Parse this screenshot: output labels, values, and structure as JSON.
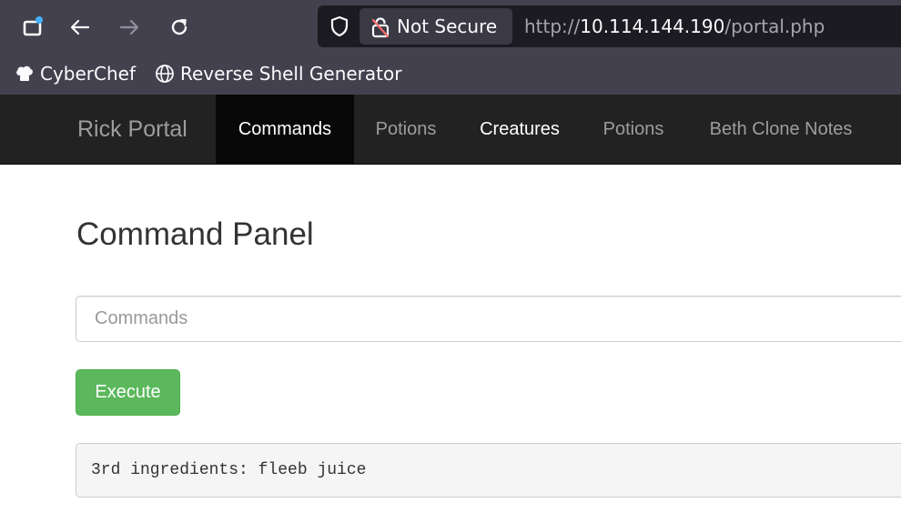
{
  "browser": {
    "security_label": "Not Secure",
    "url_scheme": "http://",
    "url_host": "10.114.144.190",
    "url_path": "/portal.php",
    "bookmarks": [
      {
        "label": "CyberChef",
        "icon": "chef-hat-icon"
      },
      {
        "label": "Reverse Shell Generator",
        "icon": "globe-icon"
      }
    ]
  },
  "navbar": {
    "brand": "Rick Portal",
    "items": [
      {
        "label": "Commands",
        "active": true
      },
      {
        "label": "Potions",
        "active": false
      },
      {
        "label": "Creatures",
        "active": false
      },
      {
        "label": "Potions",
        "active": false
      },
      {
        "label": "Beth Clone Notes",
        "active": false
      }
    ]
  },
  "main": {
    "title": "Command Panel",
    "command_input": {
      "placeholder": "Commands",
      "value": ""
    },
    "execute_label": "Execute",
    "output": "3rd ingredients: fleeb juice"
  },
  "colors": {
    "chrome_bg": "#42414d",
    "urlbar_bg": "#1c1b22",
    "navbar_bg": "#222222",
    "nav_active_bg": "#080808",
    "button_green": "#5cb85c",
    "output_bg": "#f5f5f5"
  }
}
